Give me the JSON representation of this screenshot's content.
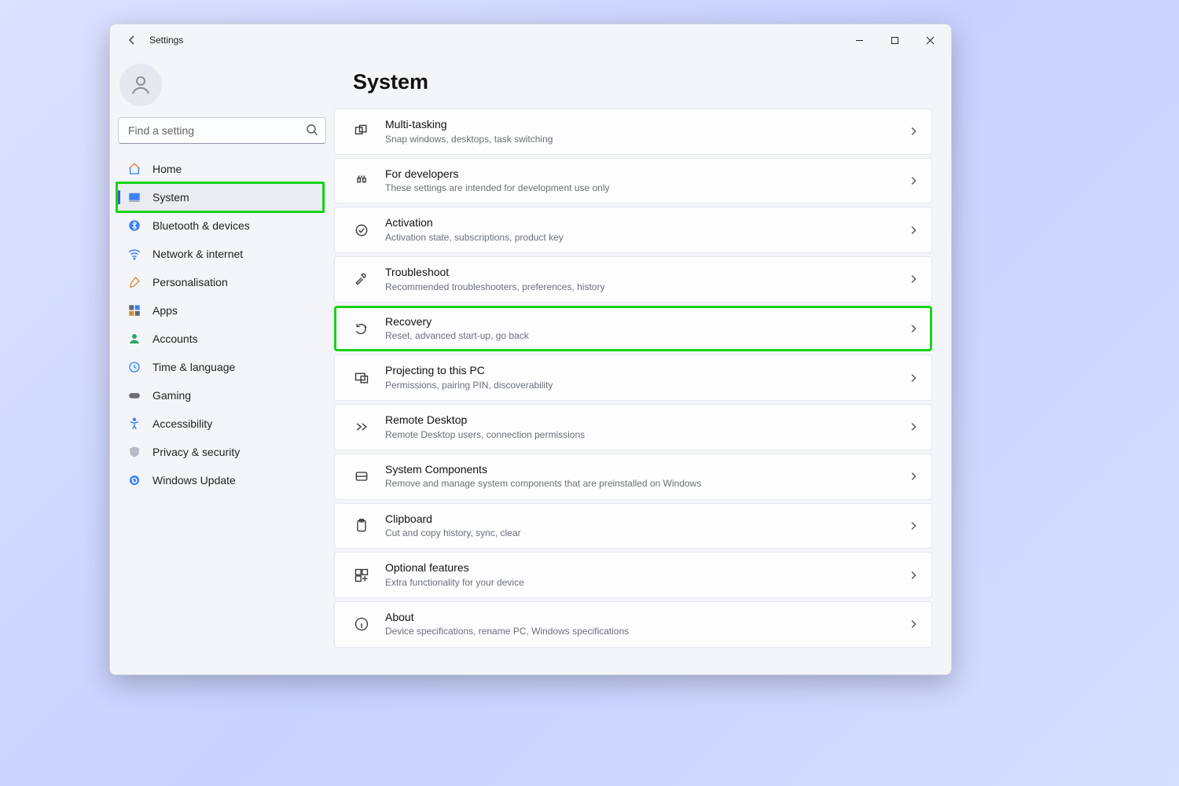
{
  "titlebar": {
    "back_tooltip": "Back",
    "title": "Settings"
  },
  "sidebar": {
    "search_placeholder": "Find a setting",
    "items": [
      {
        "label": "Home"
      },
      {
        "label": "System"
      },
      {
        "label": "Bluetooth & devices"
      },
      {
        "label": "Network & internet"
      },
      {
        "label": "Personalisation"
      },
      {
        "label": "Apps"
      },
      {
        "label": "Accounts"
      },
      {
        "label": "Time & language"
      },
      {
        "label": "Gaming"
      },
      {
        "label": "Accessibility"
      },
      {
        "label": "Privacy & security"
      },
      {
        "label": "Windows Update"
      }
    ],
    "active_index": 1,
    "highlight_index": 1
  },
  "page": {
    "title": "System",
    "cards": [
      {
        "title": "Multi-tasking",
        "desc": "Snap windows, desktops, task switching"
      },
      {
        "title": "For developers",
        "desc": "These settings are intended for development use only"
      },
      {
        "title": "Activation",
        "desc": "Activation state, subscriptions, product key"
      },
      {
        "title": "Troubleshoot",
        "desc": "Recommended troubleshooters, preferences, history"
      },
      {
        "title": "Recovery",
        "desc": "Reset, advanced start-up, go back"
      },
      {
        "title": "Projecting to this PC",
        "desc": "Permissions, pairing PIN, discoverability"
      },
      {
        "title": "Remote Desktop",
        "desc": "Remote Desktop users, connection permissions"
      },
      {
        "title": "System Components",
        "desc": "Remove and manage system components that are preinstalled on Windows"
      },
      {
        "title": "Clipboard",
        "desc": "Cut and copy history, sync, clear"
      },
      {
        "title": "Optional features",
        "desc": "Extra functionality for your device"
      },
      {
        "title": "About",
        "desc": "Device specifications, rename PC, Windows specifications"
      }
    ],
    "highlight_card_index": 4
  }
}
